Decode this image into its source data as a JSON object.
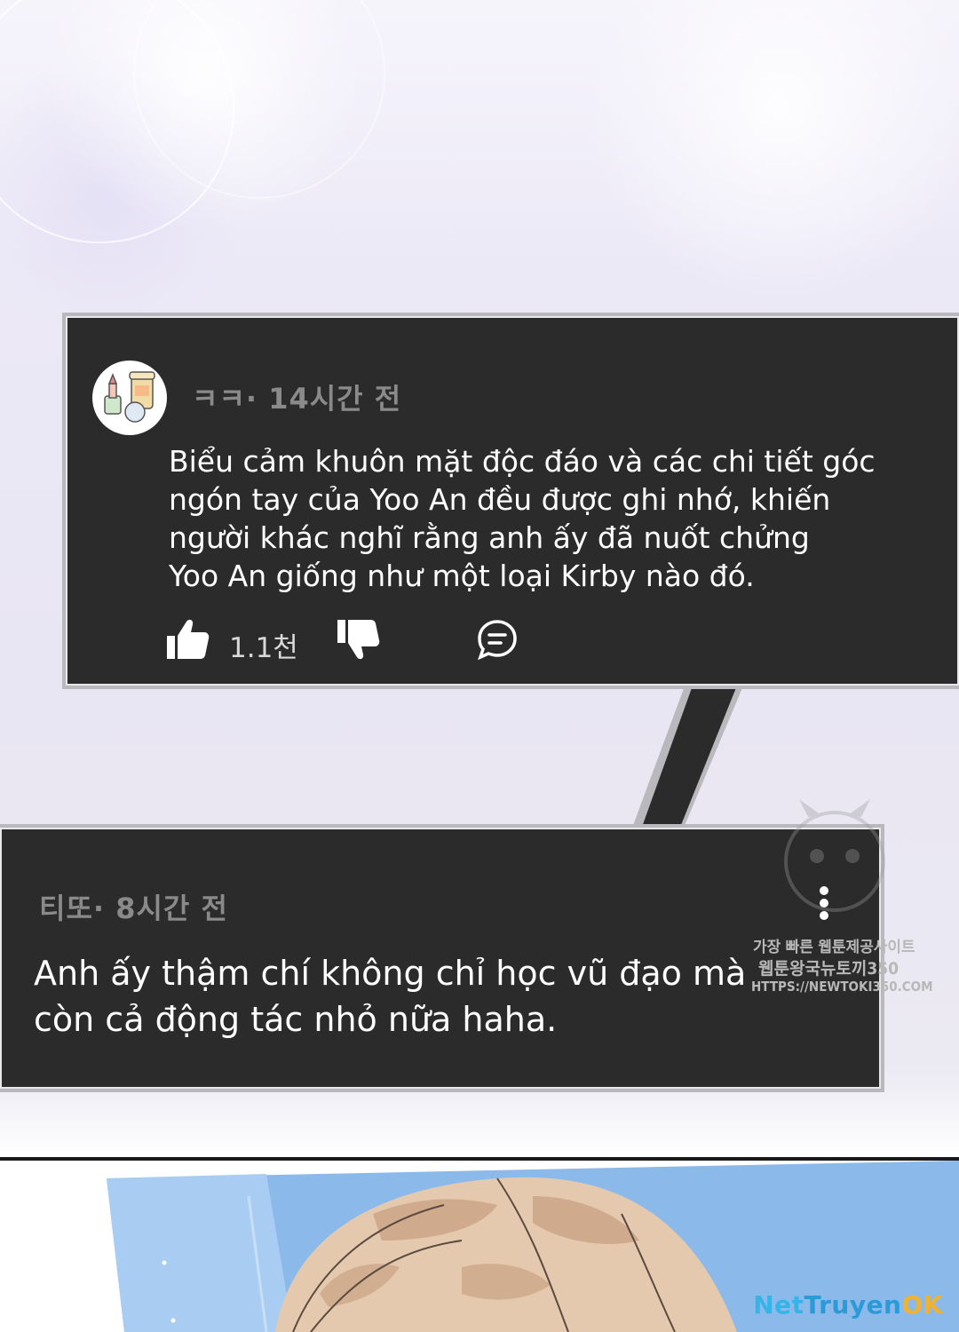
{
  "comment1": {
    "author": "ㅋㅋ",
    "time": "14시간 전",
    "avatar_icon": "cosmetics-avatar-icon",
    "text": "Biểu cảm khuôn mặt độc đáo và các chi tiết góc\nngón tay của Yoo An đều được ghi nhớ, khiến\nngười khác nghĩ rằng anh ấy đã nuốt chửng\nYoo An giống như một loại Kirby nào đó.",
    "like_count": "1.1천",
    "icons": [
      "thumbs-up-icon",
      "thumbs-down-icon",
      "reply-icon"
    ]
  },
  "comment2": {
    "author": "티또",
    "time": "8시간 전",
    "text": "Anh ấy thậm chí không chỉ học vũ đạo mà\ncòn cả động tác nhỏ nữa haha.",
    "menu_icon": "more-vertical-icon"
  },
  "watermark": {
    "line1": "가장 빠른 웹툰제공사이트",
    "line2": "웹툰왕국뉴토끼350",
    "line3": "HTTPS://NEWTOKI350.COM"
  },
  "brand": {
    "part1": "Net",
    "part2": "Truyen",
    "part3": "OK"
  },
  "colors": {
    "panel": "#2b2b2b",
    "panel_border": "#b9b9bd",
    "meta_text": "#8a8a8a",
    "body_text": "#ffffff"
  }
}
